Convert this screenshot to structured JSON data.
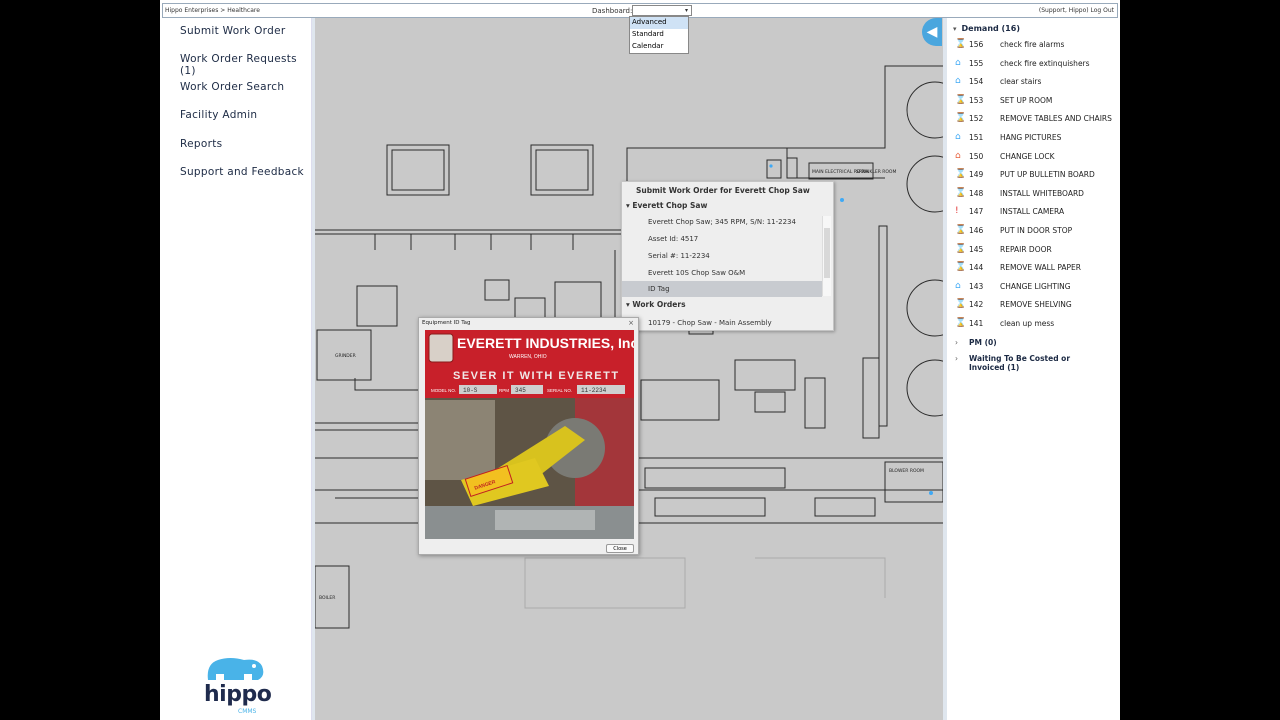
{
  "topbar": {
    "breadcrumb": "Hippo Enterprises > Healthcare",
    "dashboard_label": "Dashboard:",
    "dashboard_value": "",
    "user_links": "(Support, Hippo) Log Out"
  },
  "dashboard_options": [
    "Advanced",
    "Standard",
    "Calendar"
  ],
  "leftnav": {
    "items": [
      "Submit Work Order",
      "Work Order Requests (1)",
      "Work Order Search",
      "Facility Admin",
      "Reports",
      "Support and Feedback"
    ]
  },
  "logo": {
    "word": "hippo",
    "sub": "CMMS"
  },
  "floorplan": {
    "rooms": [
      "GRINDER",
      "BOILER",
      "BLOWER ROOM",
      "MAIN ELECTRICAL ROOM",
      "SPRINKLER ROOM"
    ]
  },
  "context_menu": {
    "title": "Submit Work Order for Everett Chop Saw",
    "section_asset": "Everett Chop Saw",
    "asset_rows": [
      "Everett Chop Saw; 345 RPM, S/N: 11-2234",
      "Asset Id: 4517",
      "Serial #: 11-2234",
      "Everett 10S Chop Saw O&M",
      "ID Tag"
    ],
    "section_workorders": "Work Orders",
    "workorder_rows": [
      "10179 - Chop Saw - Main Assembly"
    ]
  },
  "photo_dialog": {
    "title": "Equipment ID Tag",
    "close_label": "Close",
    "tag_company": "EVERETT INDUSTRIES, Inc.",
    "tag_city": "WARREN, OHIO",
    "tag_slogan": "SEVER IT WITH EVERETT",
    "tag_model_label": "MODEL NO.",
    "tag_model": "10-S",
    "tag_rpm_label": "RPM",
    "tag_rpm": "345",
    "tag_serial_label": "SERIAL NO.",
    "tag_serial": "11-2234",
    "danger_label": "DANGER"
  },
  "right_panel": {
    "demand_header": "Demand (16)",
    "work_orders": [
      {
        "num": "156",
        "text": "check fire alarms",
        "icon": "hourglass-icon",
        "color": "#8dc63f"
      },
      {
        "num": "155",
        "text": "check fire extinquishers",
        "icon": "house-icon",
        "color": "#3fa9f5"
      },
      {
        "num": "154",
        "text": "clear stairs",
        "icon": "house-icon",
        "color": "#3fa9f5"
      },
      {
        "num": "153",
        "text": "SET UP ROOM",
        "icon": "hourglass-icon",
        "color": "#8dc63f"
      },
      {
        "num": "152",
        "text": "REMOVE TABLES AND CHAIRS",
        "icon": "hourglass-icon",
        "color": "#8dc63f"
      },
      {
        "num": "151",
        "text": "HANG PICTURES",
        "icon": "house-icon",
        "color": "#3fa9f5"
      },
      {
        "num": "150",
        "text": "CHANGE LOCK",
        "icon": "house-icon",
        "color": "#e8603c"
      },
      {
        "num": "149",
        "text": "PUT UP BULLETIN BOARD",
        "icon": "hourglass-icon",
        "color": "#8dc63f"
      },
      {
        "num": "148",
        "text": "INSTALL WHITEBOARD",
        "icon": "hourglass-icon",
        "color": "#8dc63f"
      },
      {
        "num": "147",
        "text": "INSTALL CAMERA",
        "icon": "exclamation-icon",
        "color": "#e03030"
      },
      {
        "num": "146",
        "text": "PUT IN DOOR STOP",
        "icon": "hourglass-icon",
        "color": "#8dc63f"
      },
      {
        "num": "145",
        "text": "REPAIR DOOR",
        "icon": "hourglass-icon",
        "color": "#8dc63f"
      },
      {
        "num": "144",
        "text": "REMOVE WALL PAPER",
        "icon": "hourglass-icon",
        "color": "#8dc63f"
      },
      {
        "num": "143",
        "text": "CHANGE LIGHTING",
        "icon": "house-icon",
        "color": "#3fa9f5"
      },
      {
        "num": "142",
        "text": "REMOVE SHELVING",
        "icon": "hourglass-icon",
        "color": "#8dc63f"
      },
      {
        "num": "141",
        "text": "clean up mess",
        "icon": "hourglass-icon",
        "color": "#8dc63f"
      }
    ],
    "pm_header": "PM (0)",
    "waiting_header": "Waiting To Be Costed or Invoiced (1)"
  },
  "colors": {
    "accent": "#4aa6de",
    "brand_navy": "#1f2b4d",
    "brand_blue": "#49b3e8",
    "tag_red": "#c8202a"
  }
}
